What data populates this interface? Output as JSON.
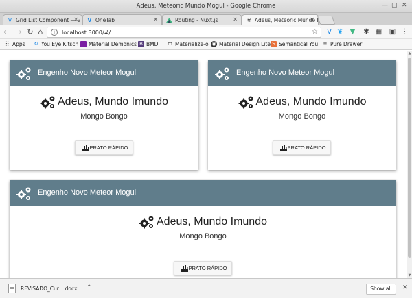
{
  "window": {
    "title": "Adeus, Meteoric Mundo Mogul - Google Chrome"
  },
  "tabs": [
    {
      "label": "Grid List Component — V",
      "icon": "vuetify-icon",
      "active": false
    },
    {
      "label": "OneTab",
      "icon": "onetab-icon",
      "active": false
    },
    {
      "label": "Routing - Nuxt.js",
      "icon": "nuxt-icon",
      "active": false
    },
    {
      "label": "Adeus, Meteoric Mundo I",
      "icon": "meteor-icon",
      "active": true
    }
  ],
  "toolbar": {
    "url": "localhost:3000/#/"
  },
  "bookmarks": [
    {
      "label": "Apps",
      "icon": "apps-grid-icon"
    },
    {
      "label": "You Eye Kitsch",
      "icon": "refresh-logo-icon"
    },
    {
      "label": "Material Demonics",
      "icon": "material-logo-icon"
    },
    {
      "label": "BMD",
      "icon": "bmd-logo-icon"
    },
    {
      "label": "Materialize-o",
      "icon": "materialize-logo-icon"
    },
    {
      "label": "Material Design Lite",
      "icon": "mdl-logo-icon"
    },
    {
      "label": "Semantical You",
      "icon": "semantic-logo-icon"
    },
    {
      "label": "Pure Drawer",
      "icon": "pure-drawer-icon"
    }
  ],
  "cards": [
    {
      "header": "Engenho Novo Meteor Mogul",
      "title": "Adeus, Mundo Imundo",
      "subtitle": "Mongo Bongo",
      "button": "PRATO RÁPIDO"
    },
    {
      "header": "Engenho Novo Meteor Mogul",
      "title": "Adeus, Mundo Imundo",
      "subtitle": "Mongo Bongo",
      "button": "PRATO RÁPIDO"
    },
    {
      "header": "Engenho Novo Meteor Mogul",
      "title": "Adeus, Mundo Imundo",
      "subtitle": "Mongo Bongo",
      "button": "PRATO RÁPIDO"
    }
  ],
  "downloads": {
    "file": "REVISADO_Cur....docx",
    "show_all": "Show all"
  },
  "colors": {
    "card_header": "#607d8b",
    "tab_active": "#f6f6f6"
  }
}
